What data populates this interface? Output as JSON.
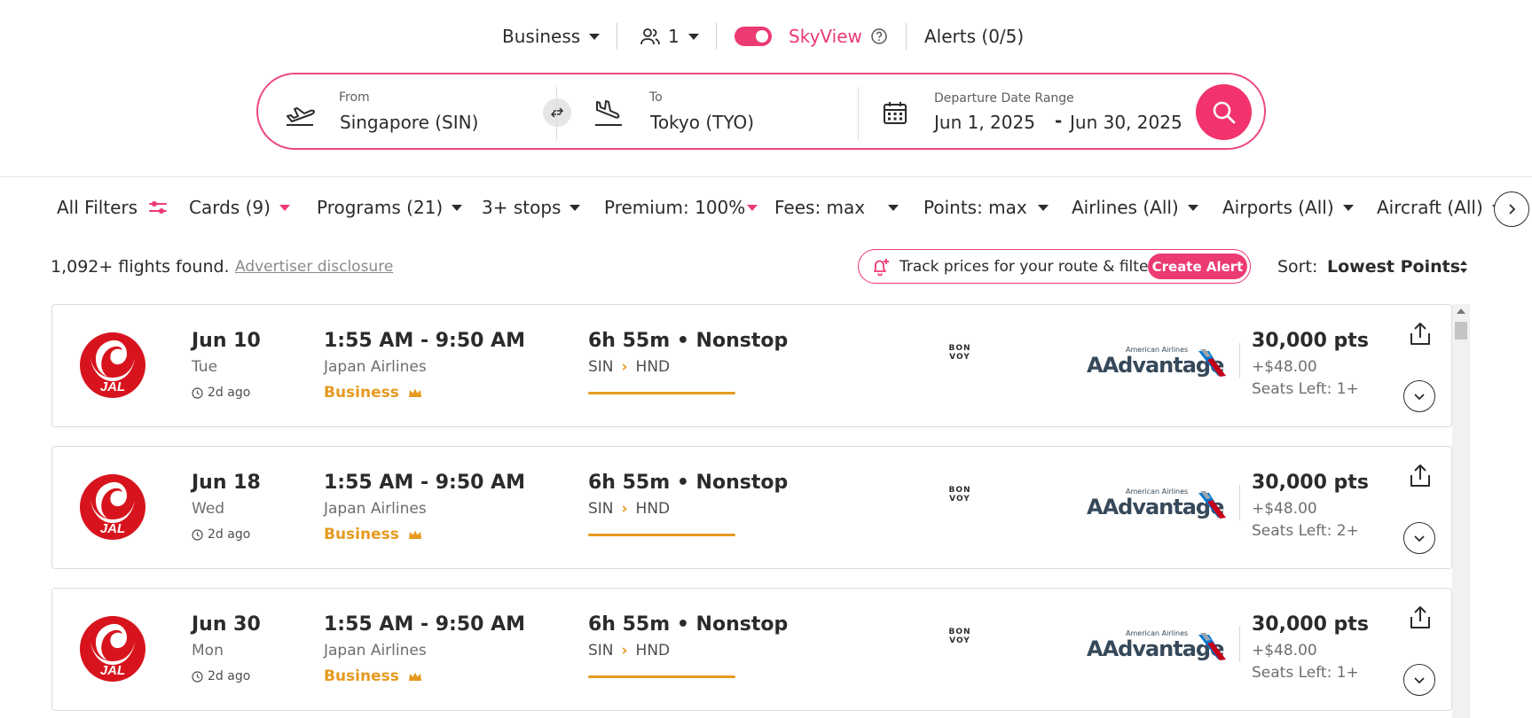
{
  "topbar": {
    "cabin": "Business",
    "passengers": "1",
    "skyview_label": "SkyView",
    "alerts": "Alerts (0/5)"
  },
  "search": {
    "from_label": "From",
    "from_value": "Singapore (SIN)",
    "to_label": "To",
    "to_value": "Tokyo (TYO)",
    "date_label": "Departure Date Range",
    "date_start": "Jun 1, 2025",
    "date_sep": "-",
    "date_end": "Jun 30, 2025"
  },
  "filters": {
    "all_filters": "All Filters",
    "cards": "Cards (9)",
    "programs": "Programs (21)",
    "stops": "3+ stops",
    "premium": "Premium: 100%",
    "fees": "Fees: max",
    "points": "Points: max",
    "airlines": "Airlines (All)",
    "airports": "Airports (All)",
    "aircraft": "Aircraft (All)"
  },
  "results": {
    "found": "1,092+ flights found.",
    "disclosure": "Advertiser disclosure",
    "track_text": "Track prices for your route & filters",
    "create_alert": "Create Alert",
    "sort_label": "Sort:",
    "sort_value": "Lowest Points"
  },
  "colors": {
    "brand_pink": "#ec3a72",
    "cabin_gold": "#e69a1f",
    "jal_red": "#d7141d"
  },
  "flights": [
    {
      "date": "Jun 10",
      "day": "Tue",
      "updated": "2d ago",
      "time": "1:55 AM - 9:50 AM",
      "airline": "Japan Airlines",
      "cabin": "Business",
      "duration": "6h 55m • Nonstop",
      "origin": "SIN",
      "destination": "HND",
      "logo_text": "JAL",
      "partner": "BON\nVOY",
      "program_small": "American Airlines",
      "program_big": "AAdvantage",
      "points": "30,000 pts",
      "fee": "+$48.00",
      "seats": "Seats Left: 1+"
    },
    {
      "date": "Jun 18",
      "day": "Wed",
      "updated": "2d ago",
      "time": "1:55 AM - 9:50 AM",
      "airline": "Japan Airlines",
      "cabin": "Business",
      "duration": "6h 55m • Nonstop",
      "origin": "SIN",
      "destination": "HND",
      "logo_text": "JAL",
      "partner": "BON\nVOY",
      "program_small": "American Airlines",
      "program_big": "AAdvantage",
      "points": "30,000 pts",
      "fee": "+$48.00",
      "seats": "Seats Left: 2+"
    },
    {
      "date": "Jun 30",
      "day": "Mon",
      "updated": "2d ago",
      "time": "1:55 AM - 9:50 AM",
      "airline": "Japan Airlines",
      "cabin": "Business",
      "duration": "6h 55m • Nonstop",
      "origin": "SIN",
      "destination": "HND",
      "logo_text": "JAL",
      "partner": "BON\nVOY",
      "program_small": "American Airlines",
      "program_big": "AAdvantage",
      "points": "30,000 pts",
      "fee": "+$48.00",
      "seats": "Seats Left: 1+"
    }
  ]
}
